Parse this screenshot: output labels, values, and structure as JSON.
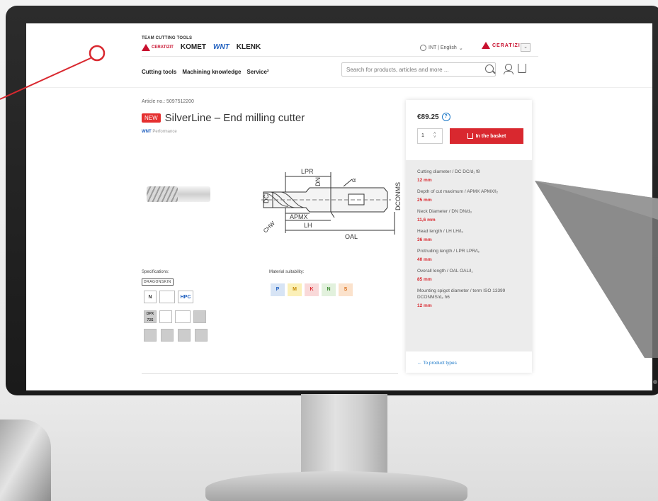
{
  "header": {
    "group_label": "TEAM CUTTING TOOLS",
    "logos": {
      "ceratizit": "CERATIZIT",
      "komet": "KOMET",
      "wnt": "WNT",
      "klenk": "KLENK"
    },
    "locale": "INT | English",
    "brand_select": "CERATIZIT",
    "nav": [
      "Cutting tools",
      "Machining knowledge",
      "Service²"
    ],
    "search_placeholder": "Search for products, articles and more ..."
  },
  "product": {
    "article_no": "Article no.: 5097512200",
    "badge": "NEW",
    "title": "SilverLine – End milling cutter",
    "brand": "WNT",
    "brand_line": "Performance",
    "drawing_labels": {
      "lpr": "LPR",
      "dn": "DN",
      "dc": "DC",
      "chw": "CHW",
      "apmx": "APMX",
      "lh": "LH",
      "oal": "OAL",
      "dconms": "DCONMS",
      "alpha": "α"
    }
  },
  "specifications": {
    "label": "Specifications:",
    "dragon": "DRAGONSKIN",
    "boxes": [
      "N",
      "HPC",
      "DPX 72S"
    ]
  },
  "materials": {
    "label": "Material suitability:",
    "items": [
      {
        "code": "P",
        "bg": "#d7e4f5",
        "color": "#1f5fbf"
      },
      {
        "code": "M",
        "bg": "#fbf0b8",
        "color": "#c78a00"
      },
      {
        "code": "K",
        "bg": "#f9d9d9",
        "color": "#d9282f"
      },
      {
        "code": "N",
        "bg": "#e2f1dd",
        "color": "#3b8a2f"
      },
      {
        "code": "S",
        "bg": "#fbe2cc",
        "color": "#d96a14"
      }
    ]
  },
  "purchase": {
    "price": "€89.25",
    "quantity": "1",
    "basket_label": "In the basket"
  },
  "specs": [
    {
      "name": "Cutting diameter / DC DC/d₁ f8",
      "value": "12 mm"
    },
    {
      "name": "Depth of cut maximum / APMX APMX/l₂",
      "value": "25 mm"
    },
    {
      "name": "Neck Diameter / DN DN/d₃",
      "value": "11,6 mm"
    },
    {
      "name": "Head length / LH LH/l₃",
      "value": "36 mm"
    },
    {
      "name": "Protruding length / LPR LPR/l₅",
      "value": "40 mm"
    },
    {
      "name": "Overall length / OAL OAL/l₁",
      "value": "85 mm"
    },
    {
      "name": "Mounting spigot diameter / term ISO 13399 DCONMS/d₂ h6",
      "value": "12 mm"
    }
  ],
  "back_link": "←  To product types",
  "colors": {
    "accent_red": "#d9282f",
    "link_blue": "#1f7ac8"
  }
}
